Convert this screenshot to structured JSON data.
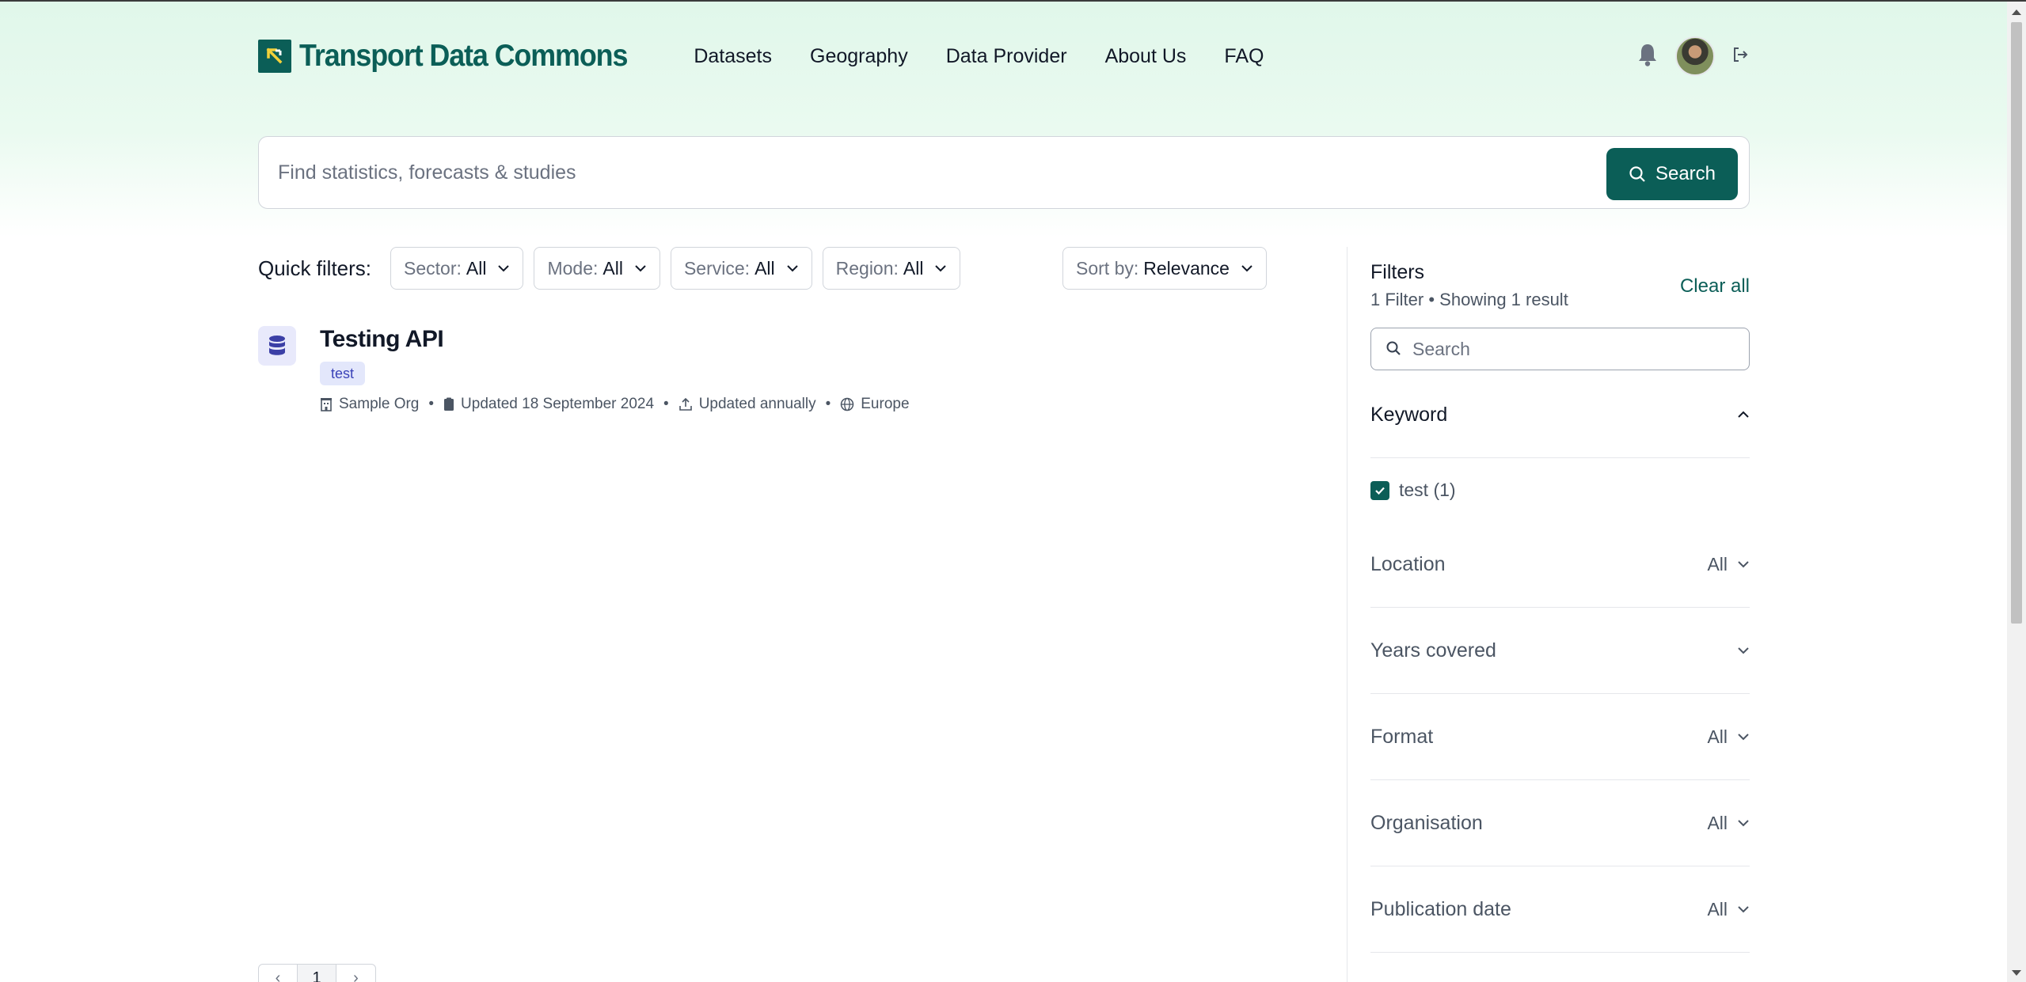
{
  "brand": {
    "name": "Transport Data Commons",
    "color": "#0b5e57"
  },
  "nav": [
    "Datasets",
    "Geography",
    "Data Provider",
    "About Us",
    "FAQ"
  ],
  "header_icons": [
    "bell-icon",
    "avatar",
    "logout-icon"
  ],
  "search": {
    "placeholder": "Find statistics, forecasts & studies",
    "button": "Search"
  },
  "quick_filters": {
    "label": "Quick filters:",
    "items": [
      {
        "key": "Sector:",
        "value": "All"
      },
      {
        "key": "Mode:",
        "value": "All"
      },
      {
        "key": "Service:",
        "value": "All"
      },
      {
        "key": "Region:",
        "value": "All"
      }
    ],
    "sort": {
      "key": "Sort by:",
      "value": "Relevance"
    }
  },
  "results": [
    {
      "title": "Testing API",
      "tag": "test",
      "organization": "Sample Org",
      "updated": "Updated 18 September 2024",
      "frequency": "Updated annually",
      "region": "Europe"
    }
  ],
  "pagination": {
    "prev": "‹",
    "current": "1",
    "next": "›"
  },
  "sidebar": {
    "title": "Filters",
    "subtitle": "1 Filter • Showing 1 result",
    "clear": "Clear all",
    "search_placeholder": "Search",
    "keyword": {
      "label": "Keyword",
      "option": "test (1)",
      "checked": true
    },
    "facets": [
      {
        "label": "Location",
        "value": "All"
      },
      {
        "label": "Years covered",
        "value": ""
      },
      {
        "label": "Format",
        "value": "All"
      },
      {
        "label": "Organisation",
        "value": "All"
      },
      {
        "label": "Publication date",
        "value": "All"
      }
    ]
  }
}
